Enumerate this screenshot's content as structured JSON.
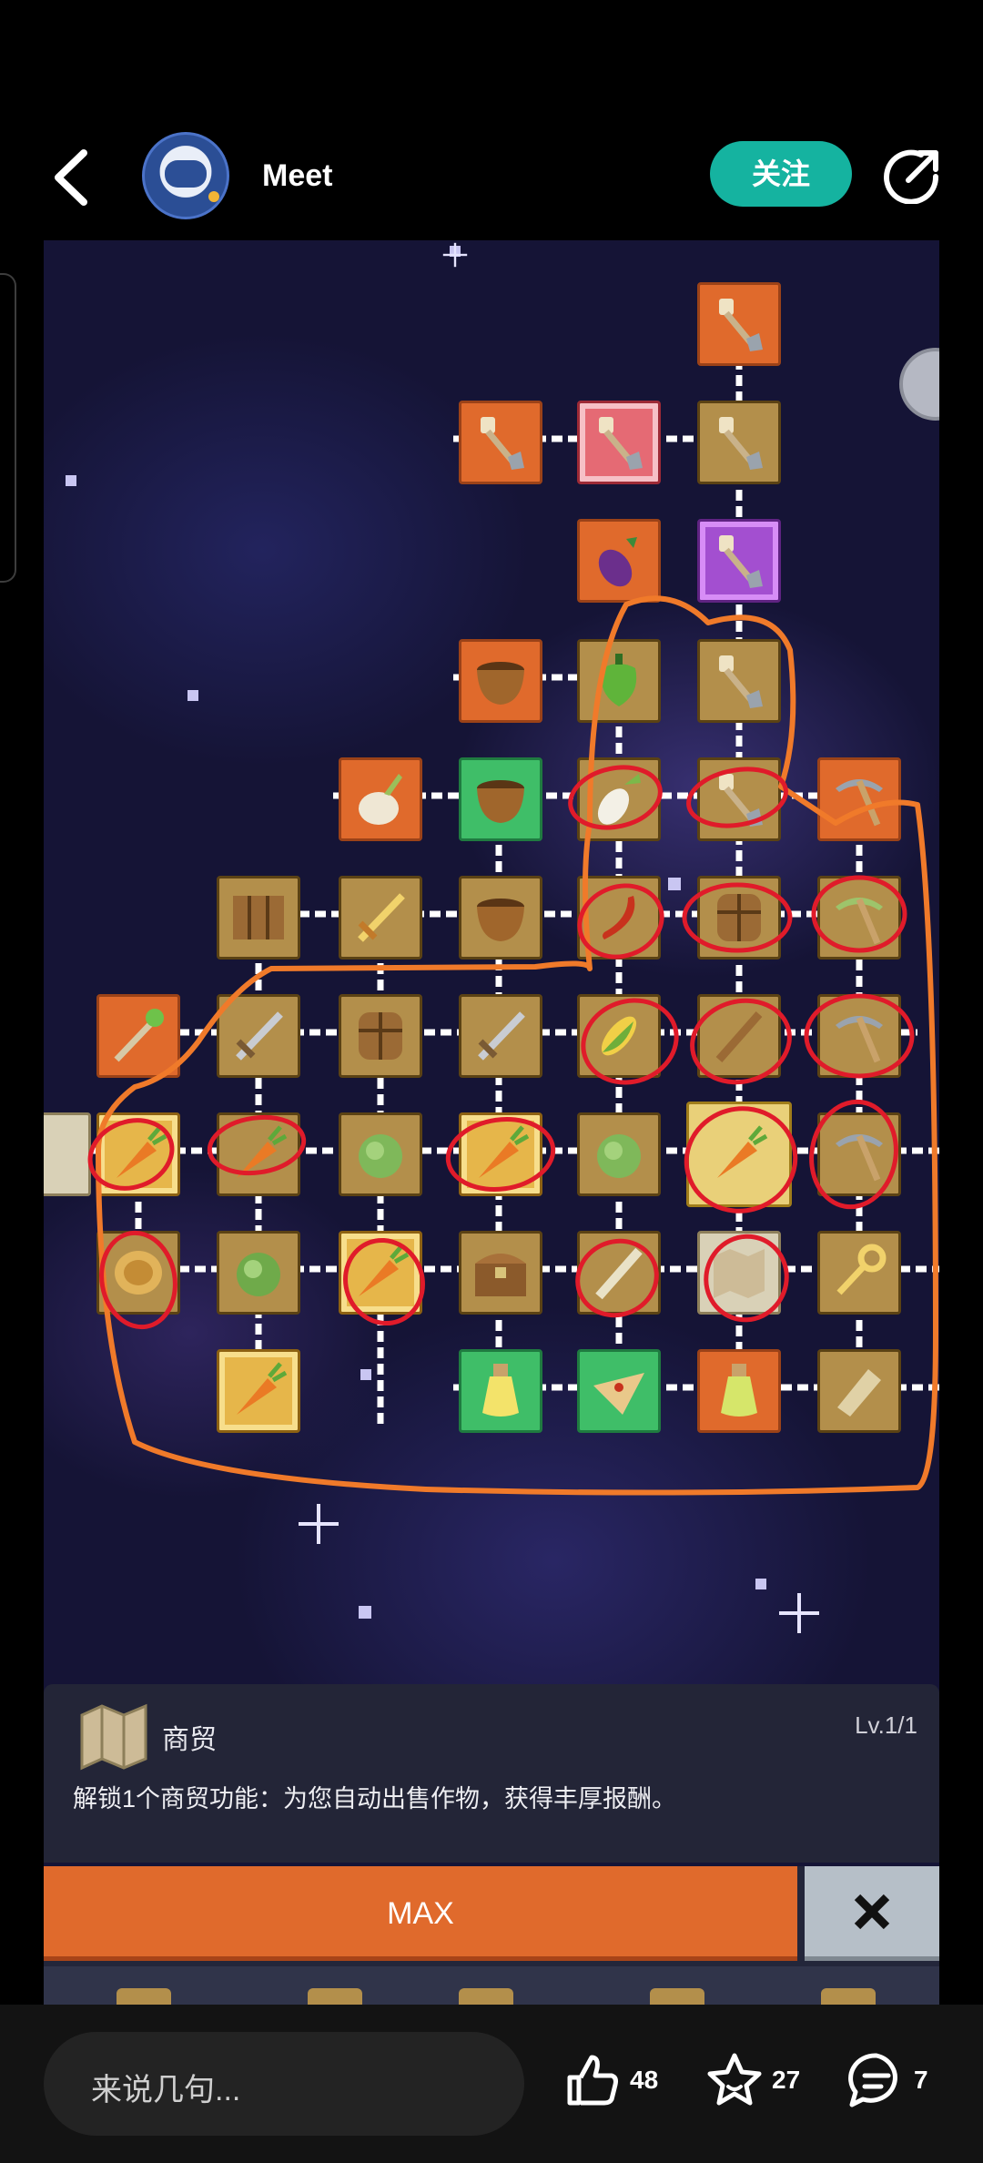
{
  "header": {
    "author_name": "Meet",
    "follow_label": "关注"
  },
  "skill_panel": {
    "title": "商贸",
    "level": "Lv.1/1",
    "description": "解锁1个商贸功能：为您自动出售作物，获得丰厚报酬。",
    "max_label": "MAX"
  },
  "bottom_bar": {
    "comment_placeholder": "来说几句...",
    "likes": "48",
    "favorites": "27",
    "comments": "7"
  },
  "colors": {
    "accent_teal": "#15b3a0",
    "button_orange": "#e06a2c",
    "annotation_red": "#e01b2a",
    "annotation_orange": "#f07a2a"
  }
}
